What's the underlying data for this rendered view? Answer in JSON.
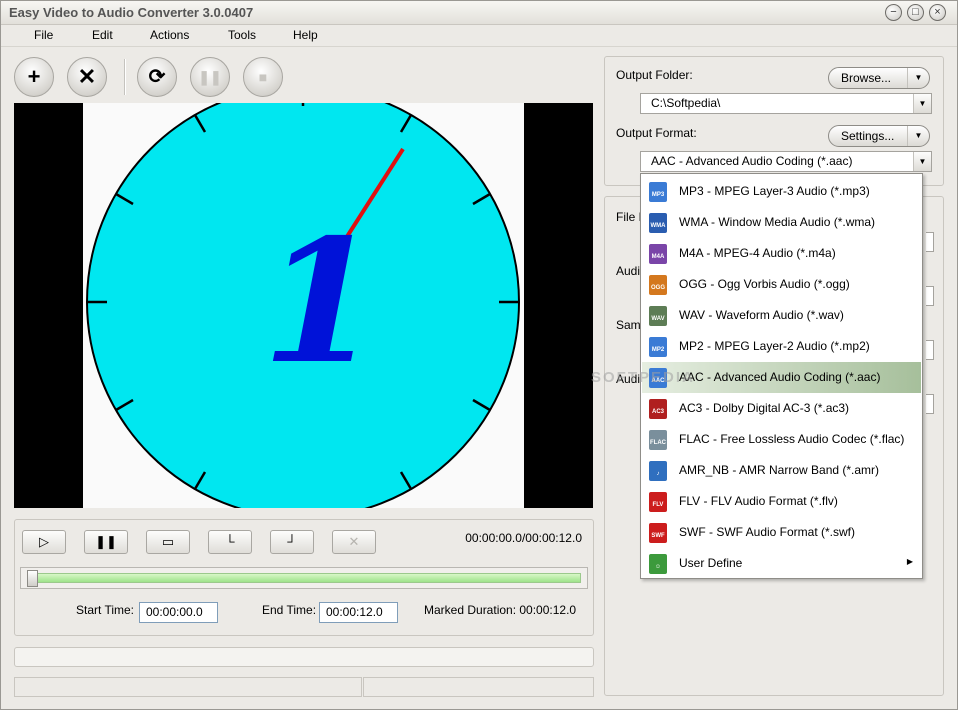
{
  "window": {
    "title": "Easy Video to Audio Converter 3.0.0407",
    "min": "−",
    "max": "□",
    "close": "×"
  },
  "menu": [
    "File",
    "Edit",
    "Actions",
    "Tools",
    "Help"
  ],
  "toolbar": {
    "add": "+",
    "remove": "✕",
    "convert": "⟳",
    "pause": "❚❚",
    "stop": "■"
  },
  "player": {
    "time_readout": "00:00:00.0/00:00:12.0",
    "play": "▷",
    "pause": "❚❚",
    "stop": "▭",
    "mark_start": "└",
    "mark_end": "┘",
    "clear": "✕",
    "start_label": "Start Time:",
    "start_value": "00:00:00.0",
    "end_label": "End Time:",
    "end_value": "00:00:12.0",
    "duration_label": "Marked Duration: 00:00:12.0",
    "position": 0
  },
  "video": {
    "frame_digit": "1"
  },
  "output": {
    "folder_label": "Output Folder:",
    "browse": "Browse...",
    "folder_value": "C:\\Softpedia\\",
    "format_label": "Output Format:",
    "settings": "Settings...",
    "format_value": "AAC - Advanced Audio Coding (*.aac)"
  },
  "params": {
    "file": "File N",
    "audio1": "Audi",
    "sample": "Samp",
    "audio2": "Audi"
  },
  "formats": [
    {
      "icon": "MP3",
      "label": "MP3 - MPEG Layer-3 Audio (*.mp3)",
      "color": "#3a7bd5"
    },
    {
      "icon": "WMA",
      "label": "WMA - Window Media Audio (*.wma)",
      "color": "#2a5db0"
    },
    {
      "icon": "M4A",
      "label": "M4A - MPEG-4 Audio (*.m4a)",
      "color": "#7a45a8"
    },
    {
      "icon": "OGG",
      "label": "OGG - Ogg Vorbis Audio (*.ogg)",
      "color": "#d4781e"
    },
    {
      "icon": "WAV",
      "label": "WAV - Waveform Audio (*.wav)",
      "color": "#5d7d55"
    },
    {
      "icon": "MP2",
      "label": "MP2 - MPEG Layer-2 Audio (*.mp2)",
      "color": "#3a7bd5"
    },
    {
      "icon": "AAC",
      "label": "AAC - Advanced Audio Coding (*.aac)",
      "color": "#3a7bd5",
      "selected": true
    },
    {
      "icon": "AC3",
      "label": "AC3 - Dolby Digital AC-3 (*.ac3)",
      "color": "#b02020"
    },
    {
      "icon": "FLAC",
      "label": "FLAC - Free Lossless Audio Codec (*.flac)",
      "color": "#7a8f9c"
    },
    {
      "icon": "♪",
      "label": "AMR_NB - AMR Narrow Band (*.amr)",
      "color": "#2f6fbf"
    },
    {
      "icon": "FLV",
      "label": "FLV - FLV Audio Format (*.flv)",
      "color": "#cc1d1d"
    },
    {
      "icon": "SWF",
      "label": "SWF - SWF Audio Format (*.swf)",
      "color": "#cc1d1d"
    },
    {
      "icon": "☺",
      "label": "User Define",
      "color": "#3c9a3c",
      "submenu": true
    }
  ],
  "watermark": "SOFTPEDIA"
}
